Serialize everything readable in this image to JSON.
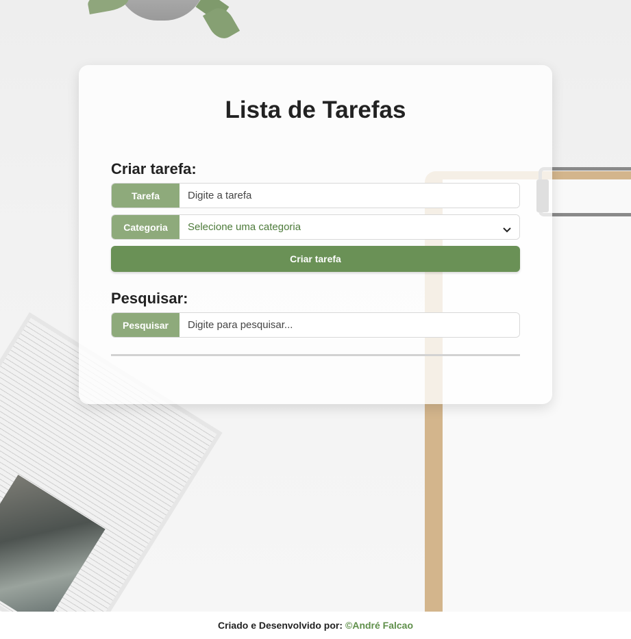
{
  "app": {
    "title": "Lista de Tarefas"
  },
  "create": {
    "section_label": "Criar tarefa:",
    "task_label": "Tarefa",
    "task_placeholder": "Digite a tarefa",
    "task_value": "",
    "category_label": "Categoria",
    "category_selected": "Selecione uma categoria",
    "button_label": "Criar tarefa"
  },
  "search": {
    "section_label": "Pesquisar:",
    "label": "Pesquisar",
    "placeholder": "Digite para pesquisar...",
    "value": ""
  },
  "footer": {
    "text": "Criado e Desenvolvido por:",
    "author": "©André Falcao"
  },
  "colors": {
    "accent": "#8eaa7b",
    "button": "#6a9156",
    "select_text": "#4c7a39",
    "author_link": "#5f8f4a"
  },
  "icons": {
    "select_chevron": "chevron-down-icon"
  }
}
